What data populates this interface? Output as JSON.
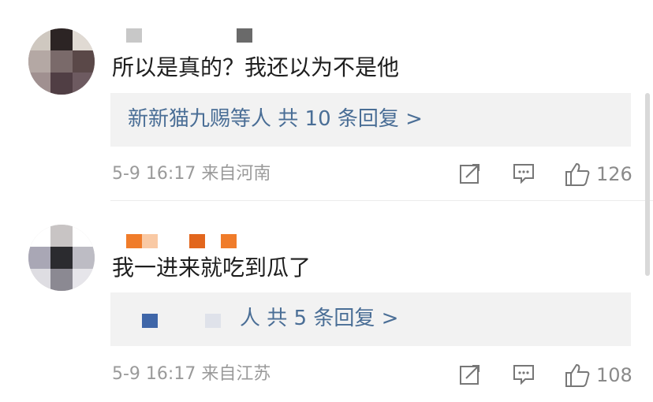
{
  "comments": [
    {
      "text": "所以是真的？我还以为不是他",
      "reply_summary": "新新猫九赐等人  共 10 条回复 >",
      "meta": "5-9 16:17  来自河南",
      "like_count": "126",
      "icons": [
        "share-icon",
        "comment-icon",
        "like-icon"
      ]
    },
    {
      "text": "我一进来就吃到瓜了",
      "reply_summary": "人  共 5 条回复 >",
      "meta": "5-9 16:17  来自江苏",
      "like_count": "108",
      "icons": [
        "share-icon",
        "comment-icon",
        "like-icon"
      ]
    }
  ],
  "colors": {
    "link": "#4a6e96",
    "meta": "#9a9a9a",
    "reply_bg": "#f2f2f2",
    "name_orange": "#f07c2a",
    "name_gray": "#c8c8c8"
  }
}
